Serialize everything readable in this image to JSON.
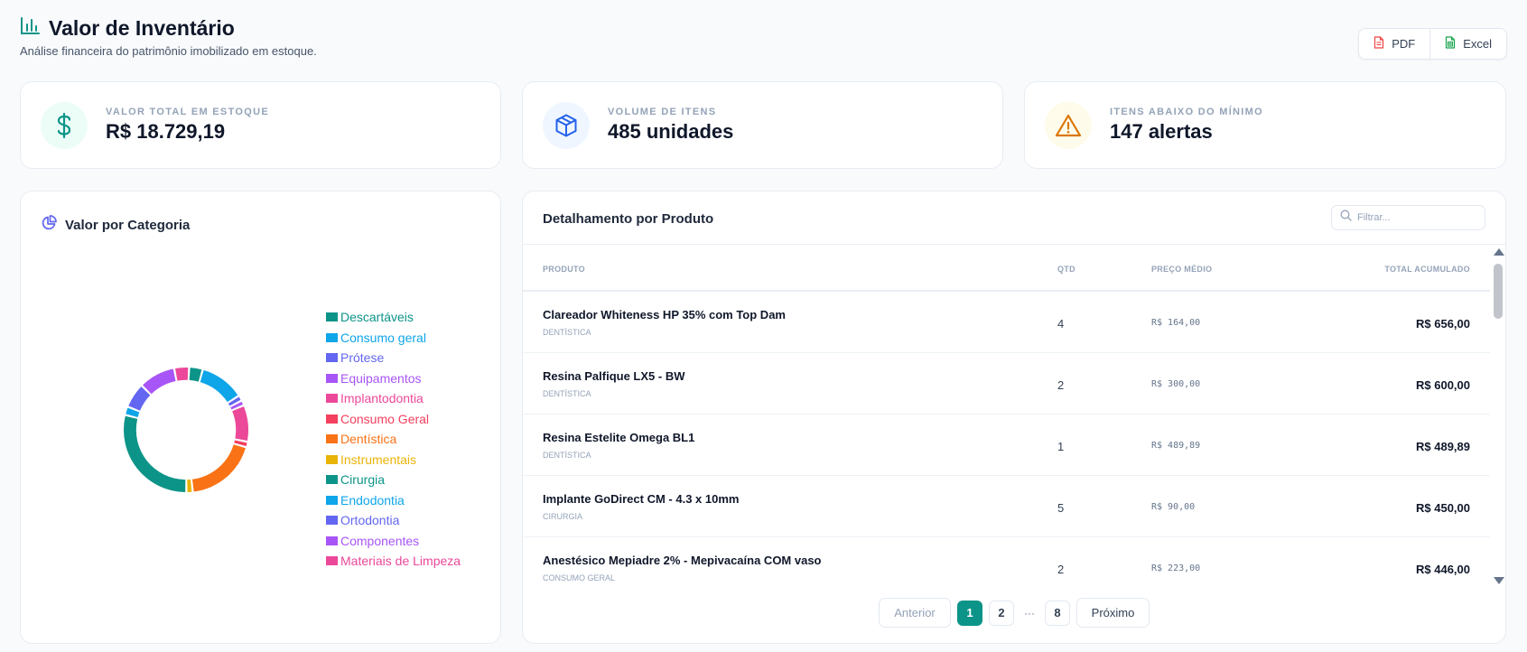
{
  "header": {
    "title": "Valor de Inventário",
    "subtitle": "Análise financeira do patrimônio imobilizado em estoque.",
    "icon": "bar-chart-icon"
  },
  "export": {
    "pdf_label": "PDF",
    "excel_label": "Excel"
  },
  "stats": [
    {
      "label": "VALOR TOTAL EM ESTOQUE",
      "value": "R$ 18.729,19",
      "icon": "dollar-icon",
      "color": "#0d9488",
      "bg": "#ecfdf7"
    },
    {
      "label": "VOLUME DE ITENS",
      "value": "485 unidades",
      "icon": "box-icon",
      "color": "#2563eb",
      "bg": "#eff6ff"
    },
    {
      "label": "ITENS ABAIXO DO MÍNIMO",
      "value": "147 alertas",
      "icon": "alert-triangle-icon",
      "color": "#d97706",
      "bg": "#fffbeb"
    }
  ],
  "category_panel": {
    "title": "Valor por Categoria",
    "icon": "pie-chart-icon"
  },
  "chart_data": {
    "type": "pie",
    "title": "Valor por Categoria",
    "categories": [
      "Descartáveis",
      "Consumo geral",
      "Prótese",
      "Equipamentos",
      "Implantodontia",
      "Consumo Geral",
      "Dentística",
      "Instrumentais",
      "Cirurgia",
      "Endodontia",
      "Ortodontia",
      "Componentes",
      "Materiais de Limpeza"
    ],
    "colors": [
      "#0d9488",
      "#0ea5e9",
      "#6366f1",
      "#a855f7",
      "#ec4899",
      "#f43f5e",
      "#f97316",
      "#eab308",
      "#0d9488",
      "#0ea5e9",
      "#6366f1",
      "#a855f7",
      "#ec4899"
    ],
    "values": [
      3.2,
      10.5,
      1.3,
      1.2,
      8.6,
      1.3,
      17.1,
      1.5,
      26.3,
      2.0,
      5.9,
      8.6,
      3.5
    ],
    "legend": "right",
    "hole": 0.8
  },
  "products": {
    "title": "Detalhamento por Produto",
    "filter_placeholder": "Filtrar...",
    "columns": [
      "PRODUTO",
      "QTD",
      "PREÇO MÉDIO",
      "TOTAL ACUMULADO"
    ],
    "rows": [
      {
        "name": "Clareador Whiteness HP 35% com Top Dam",
        "category": "DENTÍSTICA",
        "qty": "4",
        "price": "R$ 164,00",
        "total": "R$ 656,00"
      },
      {
        "name": "Resina Palfique LX5 - BW",
        "category": "DENTÍSTICA",
        "qty": "2",
        "price": "R$ 300,00",
        "total": "R$ 600,00"
      },
      {
        "name": "Resina Estelite Omega BL1",
        "category": "DENTÍSTICA",
        "qty": "1",
        "price": "R$ 489,89",
        "total": "R$ 489,89"
      },
      {
        "name": "Implante GoDirect CM - 4.3 x 10mm",
        "category": "CIRURGIA",
        "qty": "5",
        "price": "R$ 90,00",
        "total": "R$ 450,00"
      },
      {
        "name": "Anestésico Mepiadre 2% - Mepivacaína COM vaso",
        "category": "CONSUMO GERAL",
        "qty": "2",
        "price": "R$ 223,00",
        "total": "R$ 446,00"
      }
    ]
  },
  "pagination": {
    "prev_label": "Anterior",
    "next_label": "Próximo",
    "pages": [
      "1",
      "2",
      "8"
    ],
    "ellipsis": "···",
    "current": "1"
  }
}
